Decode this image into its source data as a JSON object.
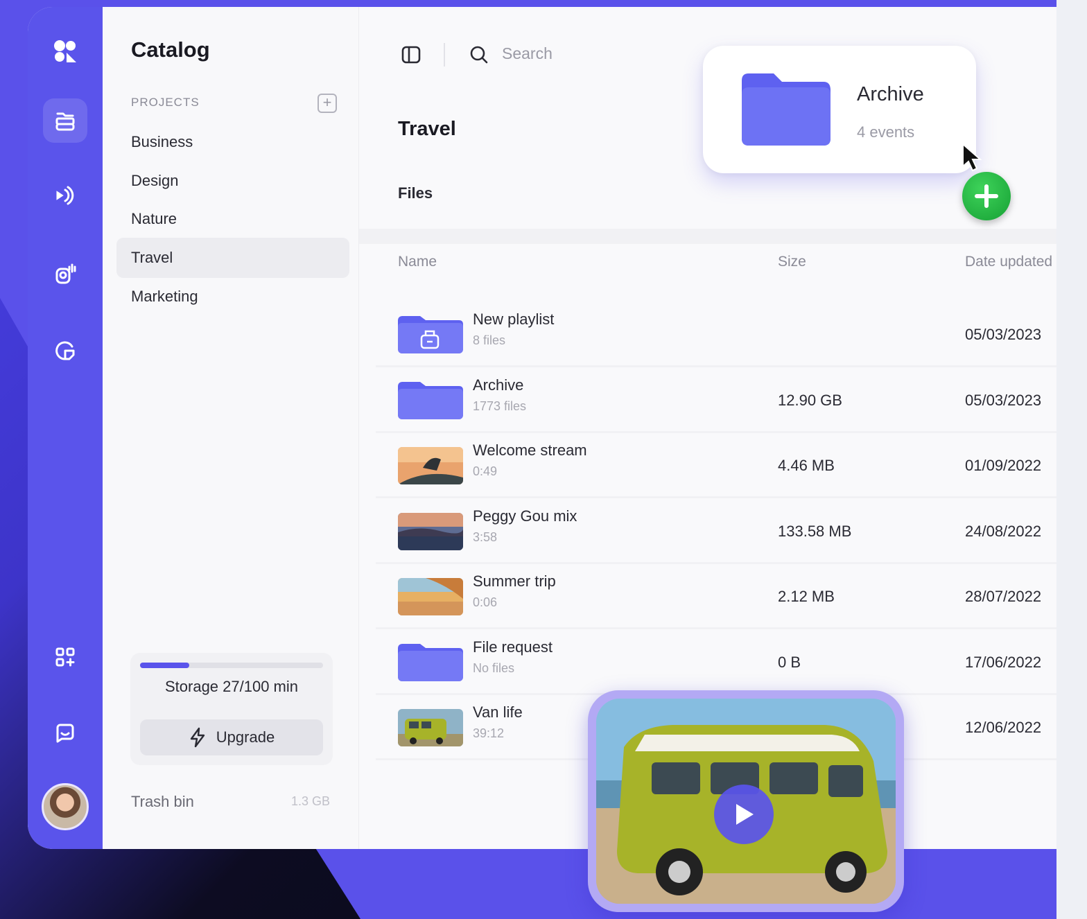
{
  "sidebar": {
    "title": "Catalog",
    "projects_label": "PROJECTS",
    "projects": [
      "Business",
      "Design",
      "Nature",
      "Travel",
      "Marketing"
    ],
    "active_project": "Travel",
    "storage": {
      "text": "Storage 27/100 min",
      "used_fraction": 0.27
    },
    "upgrade_label": "Upgrade",
    "trash": {
      "label": "Trash bin",
      "size": "1.3 GB"
    }
  },
  "rail": {
    "icons": [
      "logo-icon",
      "folders-icon",
      "stream-icon",
      "podcast-icon",
      "analytics-icon",
      "apps-icon",
      "chat-icon",
      "avatar"
    ]
  },
  "toolbar": {
    "search_placeholder": "Search"
  },
  "main": {
    "title": "Travel",
    "files_label": "Files",
    "columns": {
      "name": "Name",
      "size": "Size",
      "date": "Date updated"
    },
    "rows": [
      {
        "name": "New playlist",
        "sub": "8 files",
        "size": "",
        "date": "05/03/2023",
        "kind": "playlist-folder"
      },
      {
        "name": "Archive",
        "sub": "1773 files",
        "size": "12.90 GB",
        "date": "05/03/2023",
        "kind": "folder"
      },
      {
        "name": "Welcome stream",
        "sub": "0:49",
        "size": "4.46 MB",
        "date": "01/09/2022",
        "kind": "photo-skate"
      },
      {
        "name": "Peggy Gou mix",
        "sub": "3:58",
        "size": "133.58 MB",
        "date": "24/08/2022",
        "kind": "photo-lake"
      },
      {
        "name": "Summer trip",
        "sub": "0:06",
        "size": "2.12 MB",
        "date": "28/07/2022",
        "kind": "photo-beach"
      },
      {
        "name": "File request",
        "sub": "No files",
        "size": "0 B",
        "date": "17/06/2022",
        "kind": "folder"
      },
      {
        "name": "Van life",
        "sub": "39:12",
        "size": "",
        "date": "12/06/2022",
        "kind": "photo-van"
      }
    ]
  },
  "drag_popup": {
    "title": "Archive",
    "subtitle": "4 events"
  },
  "colors": {
    "accent": "#5a54eb",
    "add": "#16a034"
  }
}
